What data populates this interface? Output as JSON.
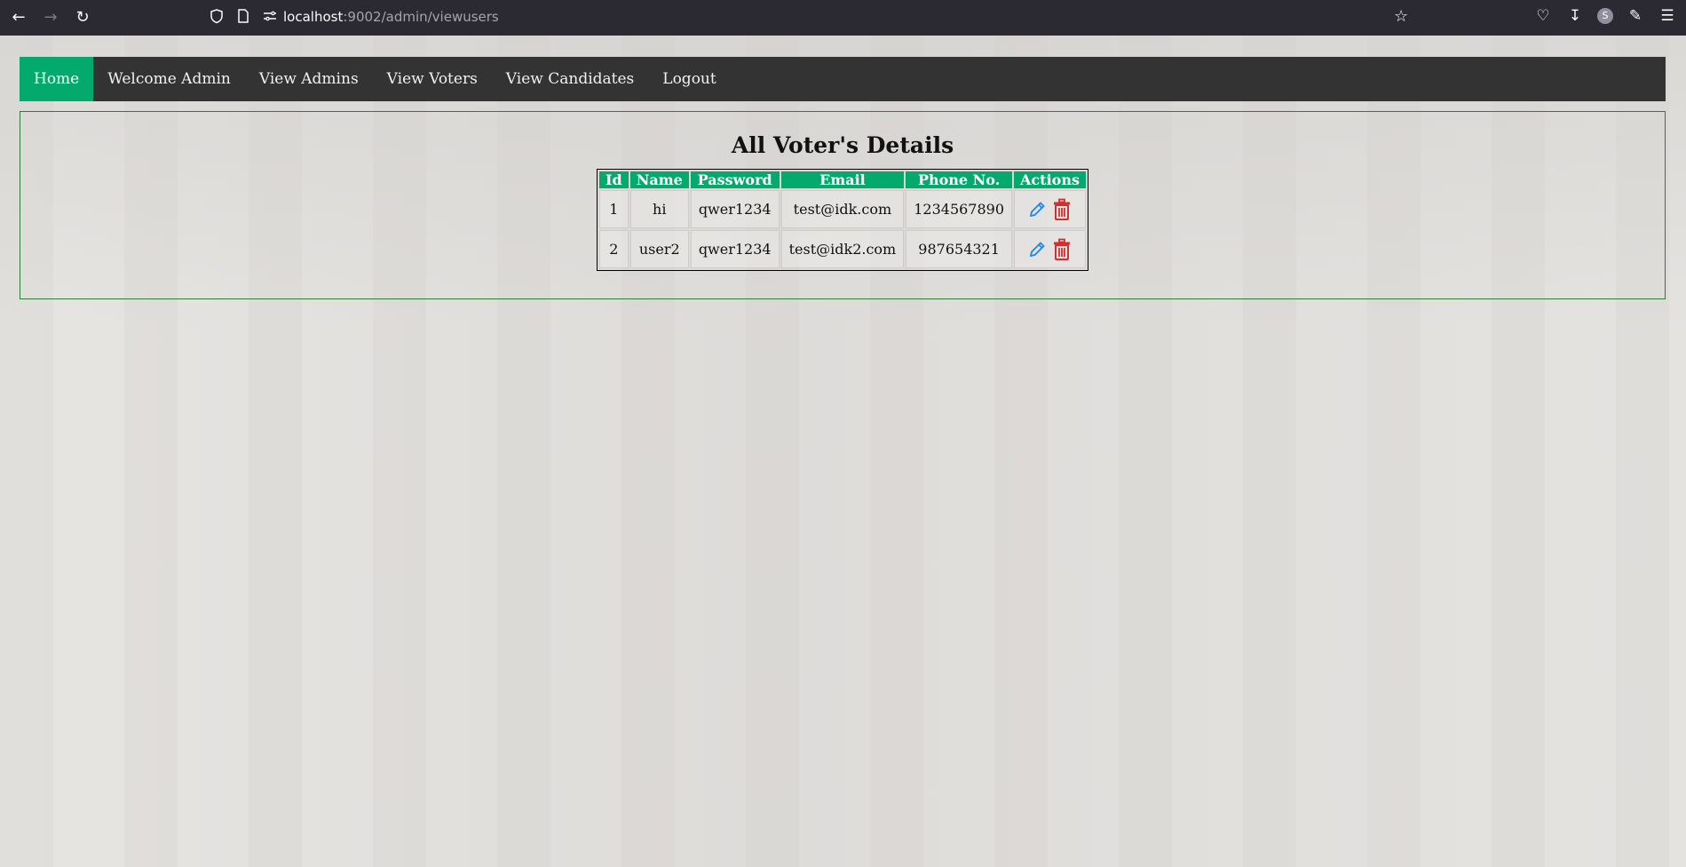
{
  "browser": {
    "url_host": "localhost",
    "url_path": ":9002/admin/viewusers",
    "profile_initial": "S"
  },
  "nav": {
    "items": [
      {
        "label": "Home",
        "active": true
      },
      {
        "label": "Welcome Admin",
        "active": false
      },
      {
        "label": "View Admins",
        "active": false
      },
      {
        "label": "View Voters",
        "active": false
      },
      {
        "label": "View Candidates",
        "active": false
      },
      {
        "label": "Logout",
        "active": false
      }
    ]
  },
  "main": {
    "title": "All Voter's Details",
    "table": {
      "headers": [
        "Id",
        "Name",
        "Password",
        "Email",
        "Phone No.",
        "Actions"
      ],
      "rows": [
        {
          "id": "1",
          "name": "hi",
          "password": "qwer1234",
          "email": "test@idk.com",
          "phone": "1234567890"
        },
        {
          "id": "2",
          "name": "user2",
          "password": "qwer1234",
          "email": "test@idk2.com",
          "phone": "987654321"
        }
      ]
    }
  },
  "colors": {
    "nav_bg": "#333333",
    "nav_active": "#04aa6d",
    "header_bg": "#04aa6d",
    "edit_icon": "#1e88e5",
    "delete_icon": "#d32f2f",
    "panel_border": "#2e7d32"
  },
  "icons": {
    "edit": "pencil-icon",
    "delete": "trash-icon"
  }
}
